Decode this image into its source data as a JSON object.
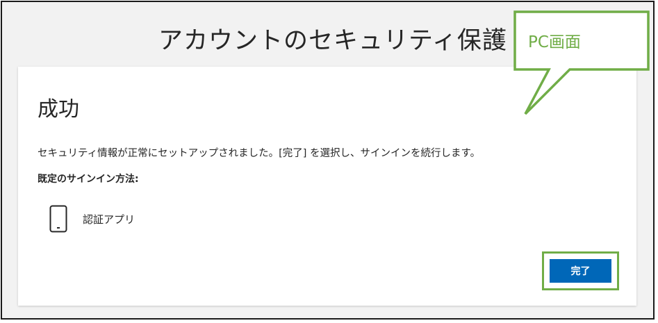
{
  "page": {
    "title": "アカウントのセキュリティ保護"
  },
  "card": {
    "heading": "成功",
    "message": "セキュリティ情報が正常にセットアップされました。[完了] を選択し、サインインを続行します。",
    "default_method_label": "既定のサインイン方法:",
    "method": {
      "name": "認証アプリ",
      "icon": "phone-icon"
    },
    "done_label": "完了"
  },
  "annotation": {
    "callout_text": "PC画面",
    "color": "#70ad47"
  },
  "colors": {
    "primary_button": "#0067b8",
    "highlight_border": "#70ad47",
    "background": "#f2f2f2"
  }
}
